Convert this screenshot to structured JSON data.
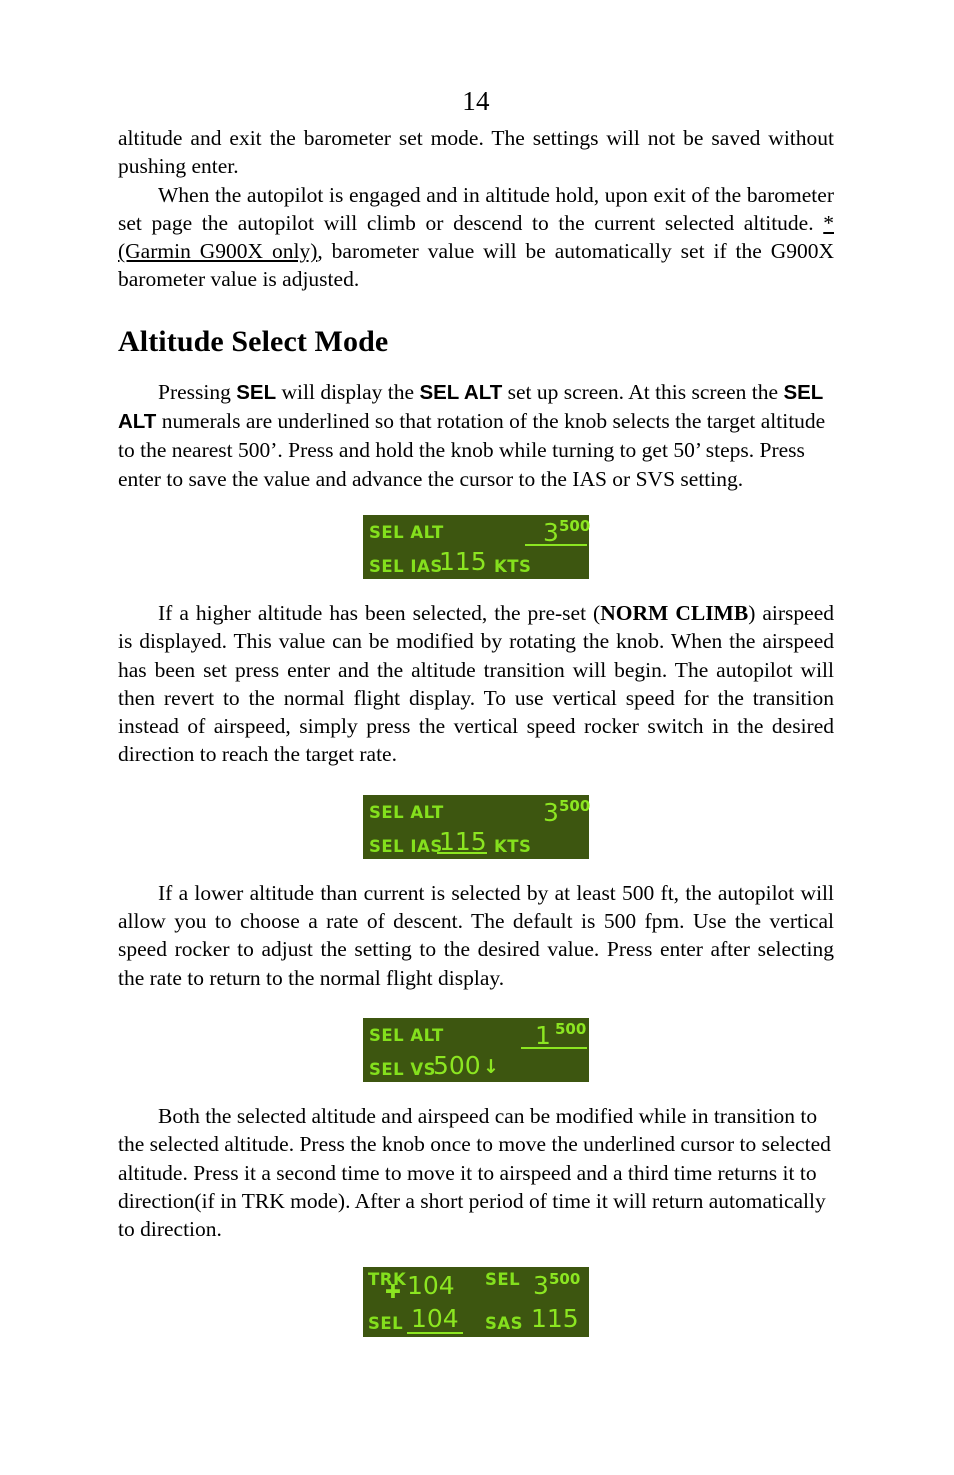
{
  "page": {
    "number": "14"
  },
  "paragraphs": {
    "p1_part1": "altitude and exit the barometer set mode.  The settings will not be saved without pushing enter.",
    "p2_part1": "When the autopilot is engaged and in altitude hold, upon exit of the barometer set page the autopilot will climb or descend to the current selected altitude.  ",
    "p2_underlined": "*(Garmin G900X only)",
    "p2_part2": ", barometer value will be automatically set if the G900X barometer value is adjusted."
  },
  "section": {
    "title": "Altitude Select Mode"
  },
  "p3": {
    "part1": "Pressing ",
    "bold1": "SEL",
    "part2": " will display the ",
    "bold2": "SEL ALT",
    "part3": " set up screen.  At this screen the ",
    "bold3": "SEL ALT",
    "part4": " numerals are underlined so that rotation of the knob selects the target altitude to the nearest 500’. Press and hold the knob while turning to get 50’ steps.  Press enter to save the value and advance the cursor to the IAS or SVS setting."
  },
  "p4": {
    "part1": "If a higher altitude has been selected, the pre-set (",
    "bold1": "NORM CLIMB",
    "part2": ") airspeed is displayed.  This value can be modified by rotating the knob.  When the airspeed has been set press enter and the altitude transition will begin.  The autopilot will then revert to the normal flight display.  To use vertical speed for the transition instead of airspeed, simply press the vertical speed rocker switch in the desired direction to reach the target rate."
  },
  "p5": {
    "text": "If a lower altitude than current is selected by at least 500 ft, the autopilot will allow you to choose a rate of descent.  The default is 500 fpm.  Use the vertical speed rocker to adjust the setting to the desired value.  Press enter after selecting the rate to return to the normal flight display."
  },
  "p6": {
    "text": "Both the selected altitude and airspeed can be modified while in transition to the selected altitude.  Press the knob once to move the underlined cursor to selected altitude.  Press it a second time to move it to airspeed and a third time returns it to direction(if in TRK mode).  After a short period of time it will return automatically to direction."
  },
  "displays": {
    "colors": {
      "background": "#3d5610",
      "text": "#84e01d",
      "value": "#8ce621"
    },
    "d1": {
      "alt_label": "SEL ALT",
      "alt_value": "3",
      "alt_sup": "500",
      "alt_underlined": true,
      "ias_label": "SEL IAS",
      "ias_value": "115",
      "ias_unit": "KTS",
      "ias_underlined": false
    },
    "d2": {
      "alt_label": "SEL ALT",
      "alt_value": "3",
      "alt_sup": "500",
      "alt_underlined": false,
      "ias_label": "SEL IAS",
      "ias_value": "115",
      "ias_unit": "KTS",
      "ias_underlined": true
    },
    "d3": {
      "alt_label": "SEL ALT",
      "alt_value": "1",
      "alt_sup": "500",
      "alt_underlined": true,
      "vs_label": "SEL VS",
      "vs_value": "500",
      "vs_arrow": "↓"
    },
    "d4": {
      "trk_label": "TRK",
      "trk_symbol": "✚",
      "trk_value": "104",
      "sel_alt_label": "SEL",
      "sel_alt_value": "3",
      "sel_alt_sup": "500",
      "sel_hdg_label": "SEL",
      "sel_hdg_value": "104",
      "sel_hdg_underlined": true,
      "sas_label": "SAS",
      "sas_value": "115"
    }
  }
}
